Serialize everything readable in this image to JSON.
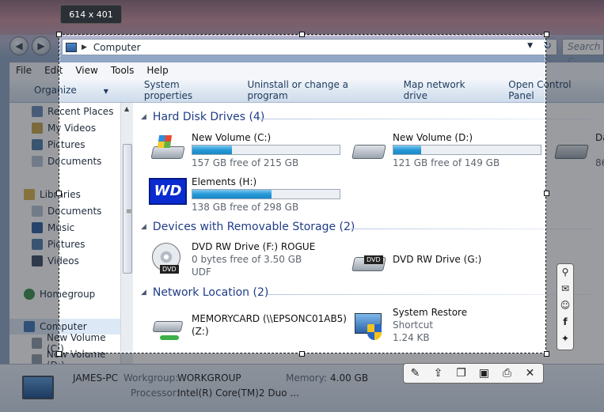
{
  "capture": {
    "size_label": "614 x 401"
  },
  "window": {
    "address": {
      "crumb": "Computer"
    },
    "search_placeholder": "Search C"
  },
  "menu": [
    "File",
    "Edit",
    "View",
    "Tools",
    "Help"
  ],
  "toolbar": {
    "organize": "Organize",
    "items": [
      "System properties",
      "Uninstall or change a program",
      "Map network drive",
      "Open Control Panel"
    ]
  },
  "navpane": {
    "favorites": [
      "Recent Places",
      "My Videos",
      "Pictures",
      "Documents"
    ],
    "libraries_label": "Libraries",
    "libraries": [
      "Documents",
      "Music",
      "Pictures",
      "Videos"
    ],
    "homegroup": "Homegroup",
    "computer": "Computer",
    "drives": [
      "New Volume (C:)",
      "New Volume (D:)"
    ]
  },
  "groups": {
    "hdd": "Hard Disk Drives (4)",
    "removable": "Devices with Removable Storage (2)",
    "network": "Network Location (2)"
  },
  "drives": {
    "c": {
      "name": "New Volume (C:)",
      "free": "157 GB free of 215 GB",
      "used_fraction": 0.27
    },
    "d": {
      "name": "New Volume (D:)",
      "free": "121 GB free of 149 GB",
      "used_fraction": 0.19
    },
    "e_partial": {
      "name": "Da",
      "free": "86"
    },
    "h": {
      "name": "Elements (H:)",
      "free": "138 GB free of 298 GB",
      "used_fraction": 0.54,
      "logo": "WD"
    }
  },
  "removable": {
    "f": {
      "name": "DVD RW Drive (F:) ROGUE",
      "free": "0 bytes free of 3.50 GB",
      "fs": "UDF",
      "badge": "DVD"
    },
    "g": {
      "name": "DVD RW Drive (G:)",
      "badge": "DVD"
    }
  },
  "network": {
    "memcard": {
      "name": "MEMORYCARD (\\\\EPSONC01AB5)",
      "sub": "(Z:)"
    },
    "restore": {
      "name": "System Restore",
      "type": "Shortcut",
      "size": "1.24 KB"
    }
  },
  "status": {
    "pc_name": "JAMES-PC",
    "workgroup_label": "Workgroup:",
    "workgroup": "WORKGROUP",
    "memory_label": "Memory:",
    "memory": "4.00 GB",
    "processor_label": "Processor:",
    "processor": "Intel(R) Core(TM)2 Duo ..."
  },
  "tools": {
    "side": [
      "search-icon",
      "mail-icon",
      "reddit-icon",
      "facebook-icon",
      "twitter-icon"
    ],
    "bottom": [
      "pencil-icon",
      "upload-icon",
      "copy-icon",
      "save-icon",
      "print-icon",
      "close-icon"
    ]
  }
}
